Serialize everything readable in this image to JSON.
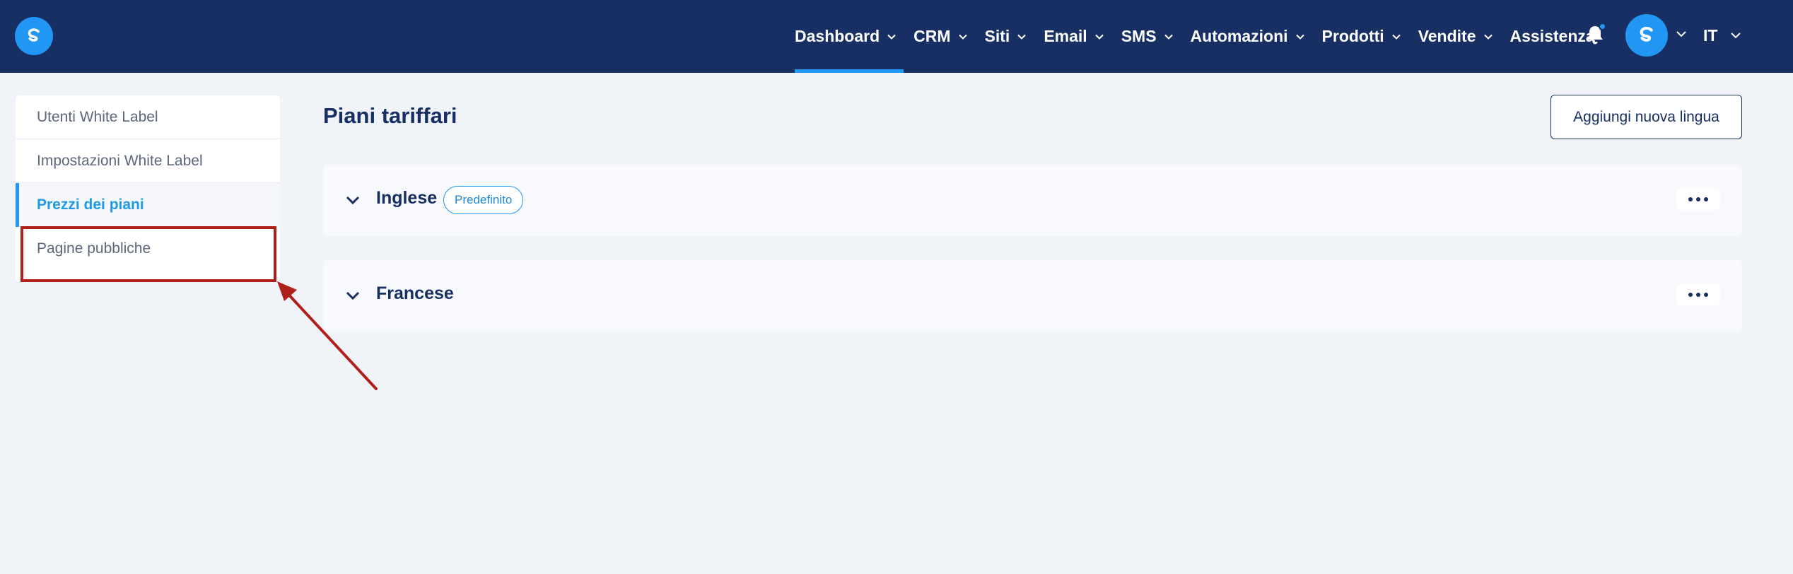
{
  "nav": {
    "items": [
      {
        "label": "Dashboard"
      },
      {
        "label": "CRM"
      },
      {
        "label": "Siti"
      },
      {
        "label": "Email"
      },
      {
        "label": "SMS"
      },
      {
        "label": "Automazioni"
      },
      {
        "label": "Prodotti"
      },
      {
        "label": "Vendite"
      },
      {
        "label": "Assistenza"
      }
    ],
    "active": "Dashboard",
    "language": "IT"
  },
  "sidebar": {
    "items": [
      {
        "label": "Utenti White Label"
      },
      {
        "label": "Impostazioni White Label"
      },
      {
        "label": "Prezzi dei piani"
      },
      {
        "label": "Pagine pubbliche"
      }
    ],
    "active": "Prezzi dei piani",
    "highlighted": "Pagine pubbliche"
  },
  "main": {
    "title": "Piani tariffari",
    "add_language_label": "Aggiungi nuova lingua",
    "languages": [
      {
        "name": "Inglese",
        "badge": "Predefinito"
      },
      {
        "name": "Francese"
      }
    ]
  },
  "colors": {
    "topbar": "#172f62",
    "accent": "#2196f3",
    "annotation": "#b0201a",
    "background": "#f0f3f8"
  }
}
